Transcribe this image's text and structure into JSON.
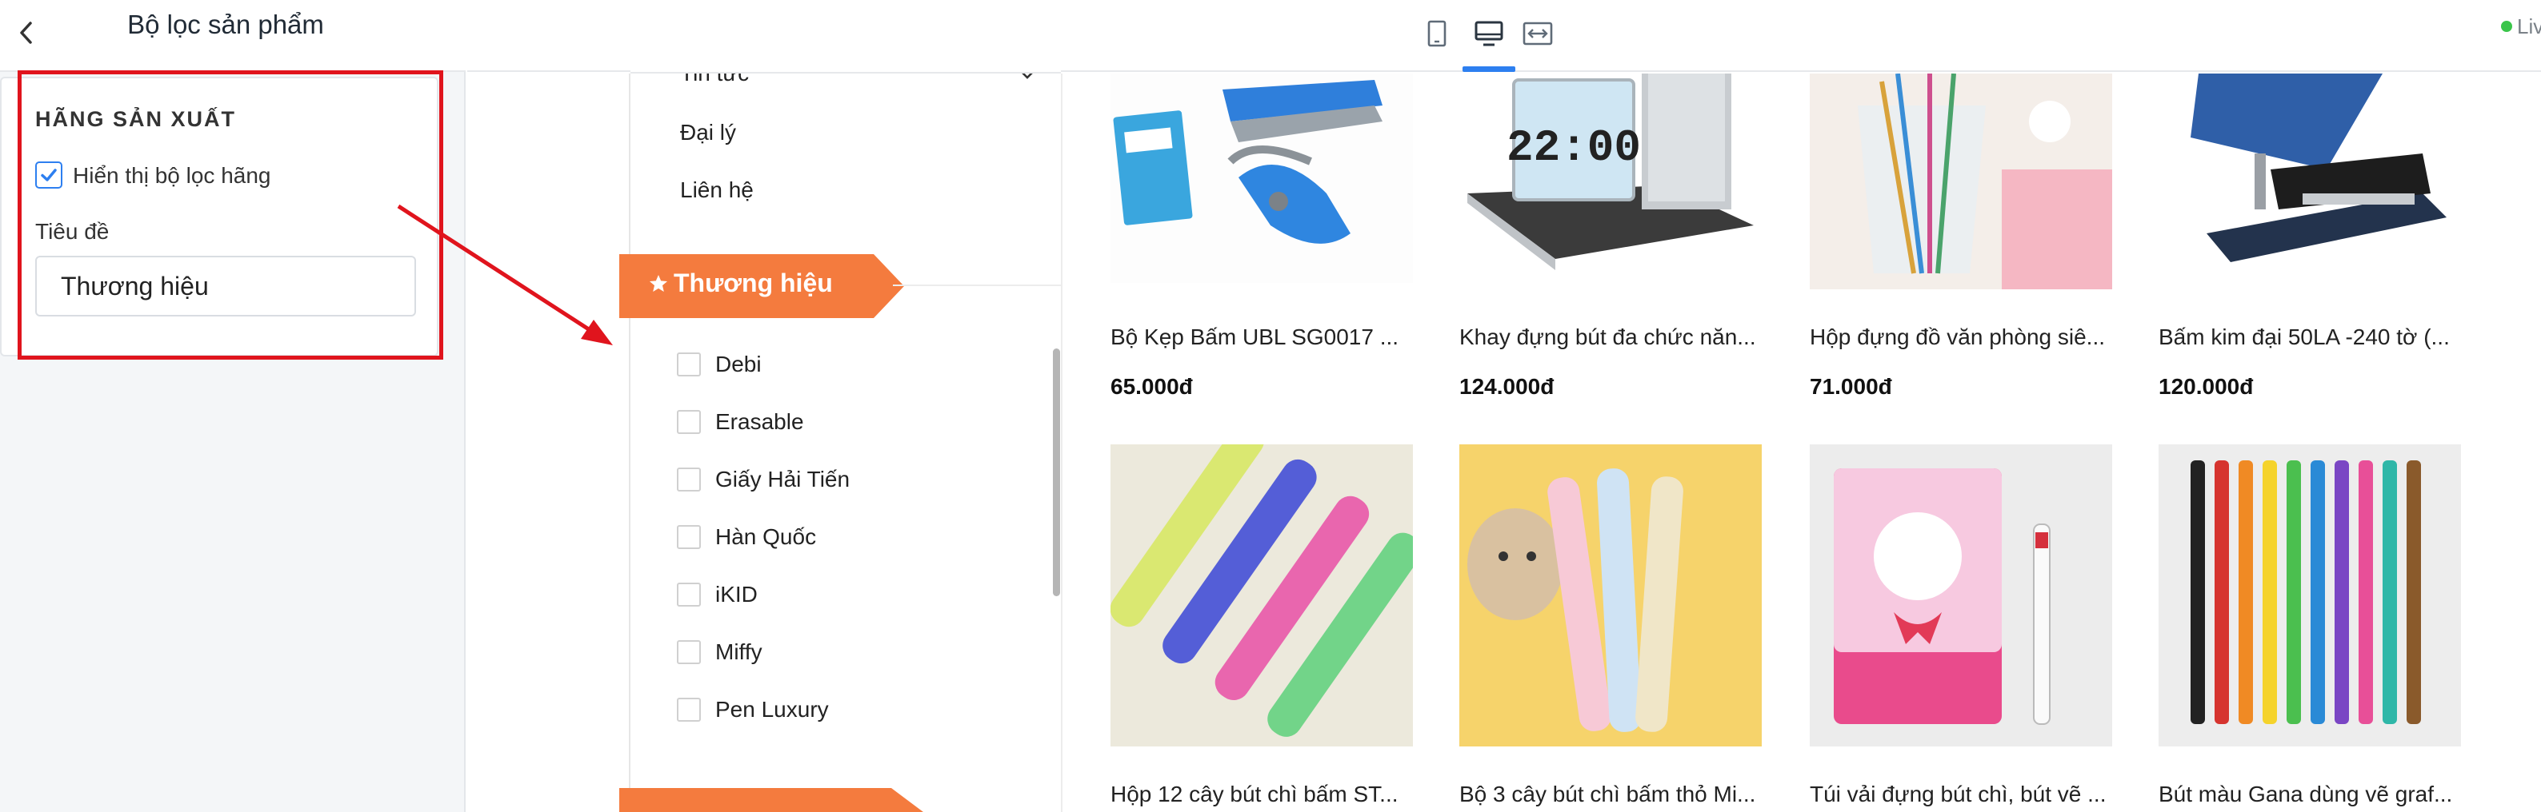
{
  "panel": {
    "title": "Bộ lọc sản phẩm",
    "section_heading": "HÃNG SẢN XUẤT",
    "show_filter_label": "Hiển thị bộ lọc hãng",
    "show_filter_checked": true,
    "title_field_label": "Tiêu đề",
    "title_field_value": "Thương hiệu"
  },
  "toolbar": {
    "devices": [
      "mobile-icon",
      "desktop-icon",
      "fullwidth-icon"
    ],
    "selected_device": "desktop",
    "live_label": "Liv"
  },
  "storefront": {
    "menu": {
      "news": "Tin tức",
      "dealer": "Đại lý",
      "contact": "Liên hệ"
    },
    "brand_filter": {
      "heading": "Thương hiệu",
      "items": [
        "Debi",
        "Erasable",
        "Giấy Hải Tiến",
        "Hàn Quốc",
        "iKID",
        "Miffy",
        "Pen Luxury"
      ]
    },
    "products": [
      {
        "name": "Bộ Kẹp Bấm UBL SG0017 ...",
        "price": "65.000đ",
        "image": "stapler-set"
      },
      {
        "name": "Khay đựng bút đa chức năn...",
        "price": "124.000đ",
        "image": "clock-pen-holder"
      },
      {
        "name": "Hộp đựng đồ văn phòng siê...",
        "price": "71.000đ",
        "image": "pen-cup"
      },
      {
        "name": "Bấm kim đại 50LA -240 tờ (...",
        "price": "120.000đ",
        "image": "heavy-stapler"
      },
      {
        "name": "Hộp 12 cây bút chì bấm ST...",
        "price": "",
        "image": "mechanical-pencils"
      },
      {
        "name": "Bộ 3 cây bút chì bấm thỏ Mi...",
        "price": "",
        "image": "rabbit-pens"
      },
      {
        "name": "Túi vải đựng bút chì, bút vẽ ...",
        "price": "",
        "image": "hello-kitty-pouch"
      },
      {
        "name": "Bút màu Gana dùng vẽ graf...",
        "price": "",
        "image": "color-markers"
      }
    ]
  },
  "colors": {
    "accent": "#2d7ff0",
    "ribbon": "#f47b3e",
    "annotation": "#e0141d",
    "live": "#3ac54a"
  }
}
